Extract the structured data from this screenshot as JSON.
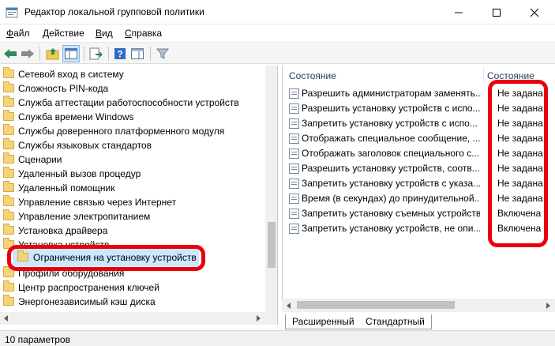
{
  "window": {
    "title": "Редактор локальной групповой политики"
  },
  "menu": [
    {
      "underline": "Ф",
      "rest": "айл"
    },
    {
      "underline": "Д",
      "rest": "ействие"
    },
    {
      "underline": "В",
      "rest": "ид"
    },
    {
      "underline": "С",
      "rest": "правка"
    }
  ],
  "toolbar": {
    "icons": [
      "back-icon",
      "forward-icon",
      "up-folder-icon",
      "show-hide-tree-icon",
      "export-list-icon",
      "help-icon",
      "properties-pane-icon",
      "filter-icon"
    ]
  },
  "tree": {
    "items": [
      "Сетевой вход в систему",
      "Сложность PIN-кода",
      "Служба аттестации работоспособности устройств",
      "Служба времени Windows",
      "Службы доверенного платформенного модуля",
      "Службы языковых стандартов",
      "Сценарии",
      "Удаленный вызов процедур",
      "Удаленный помощник",
      "Управление связью через Интернет",
      "Управление электропитанием",
      "Установка драйвера",
      "Установка устройств",
      "Профили оборудования",
      "Центр распространения ключей",
      "Энергонезависимый кэш диска"
    ],
    "selected": "Ограничения на установку устройств"
  },
  "details": {
    "col_name": "Состояние",
    "col_state": "Состояние",
    "rows": [
      {
        "name": "Разрешить администраторам заменять...",
        "state": "Не задана"
      },
      {
        "name": "Разрешить установку устройств с испо...",
        "state": "Не задана"
      },
      {
        "name": "Запретить установку устройств с испо...",
        "state": "Не задана"
      },
      {
        "name": "Отображать специальное сообщение, ...",
        "state": "Не задана"
      },
      {
        "name": "Отображать заголовок специального с...",
        "state": "Не задана"
      },
      {
        "name": "Разрешить установку устройств, соотв...",
        "state": "Не задана"
      },
      {
        "name": "Запретить установку устройств с указа...",
        "state": "Не задана"
      },
      {
        "name": "Время (в секундах) до принудительной...",
        "state": "Не задана"
      },
      {
        "name": "Запретить установку съемных устройств",
        "state": "Включена"
      },
      {
        "name": "Запретить установку устройств, не опи...",
        "state": "Включена"
      }
    ]
  },
  "tabs": [
    "Расширенный",
    "Стандартный"
  ],
  "status": "10 параметров",
  "colors": {
    "highlight": "#e8000d",
    "selection": "#cce8ff"
  }
}
